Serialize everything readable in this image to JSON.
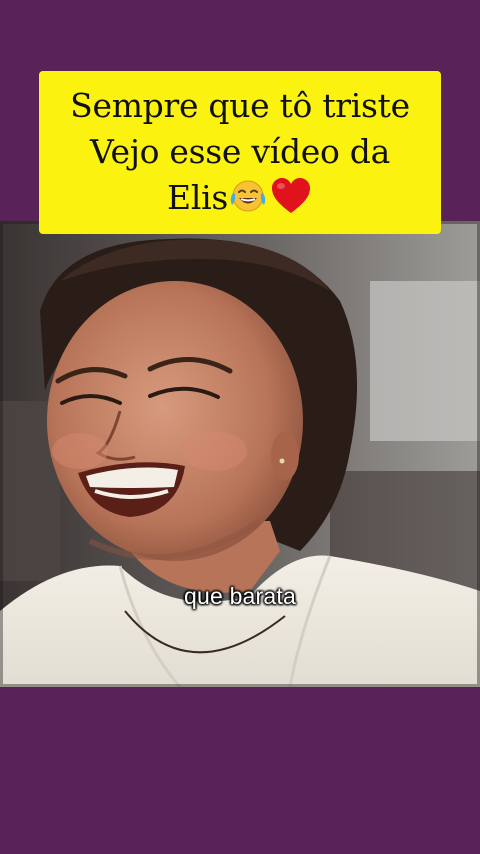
{
  "overlay_caption": {
    "line1": "Sempre que tô triste",
    "line2": "Vejo esse vídeo da",
    "line3": "Elis"
  },
  "subtitle": "que barata",
  "icons": {
    "laugh": "face-with-tears-of-joy-emoji",
    "heart": "red-heart-emoji"
  },
  "colors": {
    "background": "#582357",
    "caption_bg": "#fbf30f",
    "caption_text": "#111111",
    "subtitle_text": "#ffffff"
  }
}
